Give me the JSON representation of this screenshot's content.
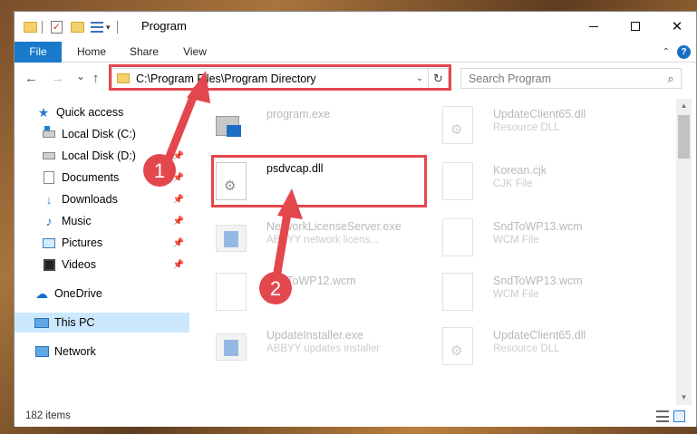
{
  "window": {
    "title": "Program",
    "minimize_glyph": "",
    "maximize_glyph": "",
    "close_glyph": "✕"
  },
  "quick_access_toolbar": {
    "icons": [
      "folder-icon",
      "properties-checkmark-icon",
      "new-folder-icon",
      "properties-icon",
      "customize-dropdown-icon"
    ],
    "dropdown_glyph": "▾"
  },
  "ribbon": {
    "tabs": [
      "File",
      "Home",
      "Share",
      "View"
    ],
    "collapse_glyph": "⌃",
    "help_glyph": "?"
  },
  "navigation": {
    "back_glyph": "←",
    "forward_glyph": "→",
    "recent_glyph": "⌄",
    "up_glyph": "↑",
    "address": "C:\\Program Files\\Program Directory",
    "address_dropdown_glyph": "⌄",
    "refresh_glyph": "↻",
    "search_placeholder": "Search Program",
    "search_glyph": "⌕"
  },
  "sidebar": {
    "items": [
      {
        "label": "Quick access",
        "icon": "star-icon",
        "pinned": false
      },
      {
        "label": "Local Disk (C:)",
        "icon": "drive-icon",
        "pinned": false
      },
      {
        "label": "Local Disk (D:)",
        "icon": "drive-icon",
        "pinned": true
      },
      {
        "label": "Documents",
        "icon": "documents-icon",
        "pinned": true
      },
      {
        "label": "Downloads",
        "icon": "downloads-icon",
        "pinned": true
      },
      {
        "label": "Music",
        "icon": "music-icon",
        "pinned": true
      },
      {
        "label": "Pictures",
        "icon": "pictures-icon",
        "pinned": true
      },
      {
        "label": "Videos",
        "icon": "videos-icon",
        "pinned": true
      },
      {
        "label": "OneDrive",
        "icon": "cloud-icon",
        "pinned": false
      },
      {
        "label": "This PC",
        "icon": "computer-icon",
        "pinned": false,
        "selected": true
      },
      {
        "label": "Network",
        "icon": "network-icon",
        "pinned": false
      }
    ],
    "pin_glyph": "📌"
  },
  "files": [
    {
      "name": "program.exe",
      "type": "",
      "icon": "exe-icon",
      "faded": true
    },
    {
      "name": "UpdateClient65.dll",
      "type": "Resource DLL",
      "icon": "dll-icon",
      "faded": true
    },
    {
      "name": "psdvcap.dll",
      "type": "",
      "icon": "dll-icon",
      "faded": false,
      "focused": true
    },
    {
      "name": "Korean.cjk",
      "type": "CJK File",
      "icon": "document-icon",
      "faded": true
    },
    {
      "name": "NetworkLicenseServer.exe",
      "type": "ABBYY network licens...",
      "icon": "app-icon",
      "faded": true
    },
    {
      "name": "SndToWP13.wcm",
      "type": "WCM File",
      "icon": "document-icon",
      "faded": true
    },
    {
      "name": "SndToWP12.wcm",
      "type": "",
      "icon": "document-icon",
      "faded": true
    },
    {
      "name": "SndToWP13.wcm",
      "type": "WCM File",
      "icon": "document-icon",
      "faded": true
    },
    {
      "name": "UpdateInstaller.exe",
      "type": "ABBYY updates installer",
      "icon": "app-icon",
      "faded": true
    },
    {
      "name": "UpdateClient65.dll",
      "type": "Resource DLL",
      "icon": "dll-icon",
      "faded": true
    }
  ],
  "scrollbar": {
    "up_glyph": "▲",
    "down_glyph": "▼"
  },
  "status": {
    "item_count": "182 items"
  },
  "callouts": [
    {
      "number": "1",
      "color": "#e3474e"
    },
    {
      "number": "2",
      "color": "#e3474e"
    }
  ],
  "colors": {
    "accent": "#1979ca",
    "selection": "#cce8ff",
    "callout": "#e3474e"
  }
}
